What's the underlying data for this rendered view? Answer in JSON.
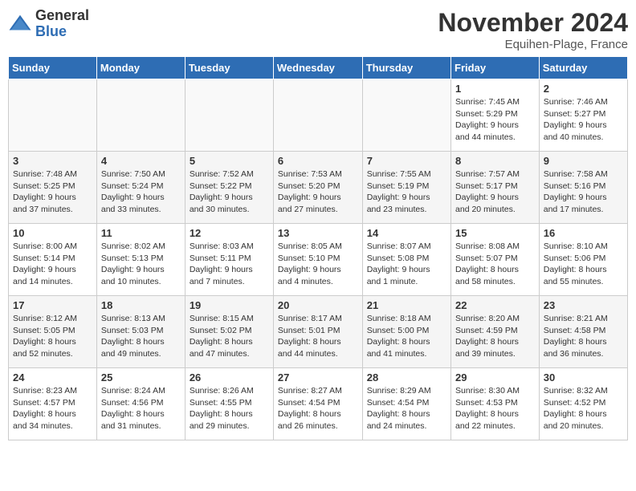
{
  "header": {
    "logo_general": "General",
    "logo_blue": "Blue",
    "month_year": "November 2024",
    "location": "Equihen-Plage, France"
  },
  "days_of_week": [
    "Sunday",
    "Monday",
    "Tuesday",
    "Wednesday",
    "Thursday",
    "Friday",
    "Saturday"
  ],
  "weeks": [
    [
      {
        "day": "",
        "info": ""
      },
      {
        "day": "",
        "info": ""
      },
      {
        "day": "",
        "info": ""
      },
      {
        "day": "",
        "info": ""
      },
      {
        "day": "",
        "info": ""
      },
      {
        "day": "1",
        "info": "Sunrise: 7:45 AM\nSunset: 5:29 PM\nDaylight: 9 hours\nand 44 minutes."
      },
      {
        "day": "2",
        "info": "Sunrise: 7:46 AM\nSunset: 5:27 PM\nDaylight: 9 hours\nand 40 minutes."
      }
    ],
    [
      {
        "day": "3",
        "info": "Sunrise: 7:48 AM\nSunset: 5:25 PM\nDaylight: 9 hours\nand 37 minutes."
      },
      {
        "day": "4",
        "info": "Sunrise: 7:50 AM\nSunset: 5:24 PM\nDaylight: 9 hours\nand 33 minutes."
      },
      {
        "day": "5",
        "info": "Sunrise: 7:52 AM\nSunset: 5:22 PM\nDaylight: 9 hours\nand 30 minutes."
      },
      {
        "day": "6",
        "info": "Sunrise: 7:53 AM\nSunset: 5:20 PM\nDaylight: 9 hours\nand 27 minutes."
      },
      {
        "day": "7",
        "info": "Sunrise: 7:55 AM\nSunset: 5:19 PM\nDaylight: 9 hours\nand 23 minutes."
      },
      {
        "day": "8",
        "info": "Sunrise: 7:57 AM\nSunset: 5:17 PM\nDaylight: 9 hours\nand 20 minutes."
      },
      {
        "day": "9",
        "info": "Sunrise: 7:58 AM\nSunset: 5:16 PM\nDaylight: 9 hours\nand 17 minutes."
      }
    ],
    [
      {
        "day": "10",
        "info": "Sunrise: 8:00 AM\nSunset: 5:14 PM\nDaylight: 9 hours\nand 14 minutes."
      },
      {
        "day": "11",
        "info": "Sunrise: 8:02 AM\nSunset: 5:13 PM\nDaylight: 9 hours\nand 10 minutes."
      },
      {
        "day": "12",
        "info": "Sunrise: 8:03 AM\nSunset: 5:11 PM\nDaylight: 9 hours\nand 7 minutes."
      },
      {
        "day": "13",
        "info": "Sunrise: 8:05 AM\nSunset: 5:10 PM\nDaylight: 9 hours\nand 4 minutes."
      },
      {
        "day": "14",
        "info": "Sunrise: 8:07 AM\nSunset: 5:08 PM\nDaylight: 9 hours\nand 1 minute."
      },
      {
        "day": "15",
        "info": "Sunrise: 8:08 AM\nSunset: 5:07 PM\nDaylight: 8 hours\nand 58 minutes."
      },
      {
        "day": "16",
        "info": "Sunrise: 8:10 AM\nSunset: 5:06 PM\nDaylight: 8 hours\nand 55 minutes."
      }
    ],
    [
      {
        "day": "17",
        "info": "Sunrise: 8:12 AM\nSunset: 5:05 PM\nDaylight: 8 hours\nand 52 minutes."
      },
      {
        "day": "18",
        "info": "Sunrise: 8:13 AM\nSunset: 5:03 PM\nDaylight: 8 hours\nand 49 minutes."
      },
      {
        "day": "19",
        "info": "Sunrise: 8:15 AM\nSunset: 5:02 PM\nDaylight: 8 hours\nand 47 minutes."
      },
      {
        "day": "20",
        "info": "Sunrise: 8:17 AM\nSunset: 5:01 PM\nDaylight: 8 hours\nand 44 minutes."
      },
      {
        "day": "21",
        "info": "Sunrise: 8:18 AM\nSunset: 5:00 PM\nDaylight: 8 hours\nand 41 minutes."
      },
      {
        "day": "22",
        "info": "Sunrise: 8:20 AM\nSunset: 4:59 PM\nDaylight: 8 hours\nand 39 minutes."
      },
      {
        "day": "23",
        "info": "Sunrise: 8:21 AM\nSunset: 4:58 PM\nDaylight: 8 hours\nand 36 minutes."
      }
    ],
    [
      {
        "day": "24",
        "info": "Sunrise: 8:23 AM\nSunset: 4:57 PM\nDaylight: 8 hours\nand 34 minutes."
      },
      {
        "day": "25",
        "info": "Sunrise: 8:24 AM\nSunset: 4:56 PM\nDaylight: 8 hours\nand 31 minutes."
      },
      {
        "day": "26",
        "info": "Sunrise: 8:26 AM\nSunset: 4:55 PM\nDaylight: 8 hours\nand 29 minutes."
      },
      {
        "day": "27",
        "info": "Sunrise: 8:27 AM\nSunset: 4:54 PM\nDaylight: 8 hours\nand 26 minutes."
      },
      {
        "day": "28",
        "info": "Sunrise: 8:29 AM\nSunset: 4:54 PM\nDaylight: 8 hours\nand 24 minutes."
      },
      {
        "day": "29",
        "info": "Sunrise: 8:30 AM\nSunset: 4:53 PM\nDaylight: 8 hours\nand 22 minutes."
      },
      {
        "day": "30",
        "info": "Sunrise: 8:32 AM\nSunset: 4:52 PM\nDaylight: 8 hours\nand 20 minutes."
      }
    ]
  ]
}
